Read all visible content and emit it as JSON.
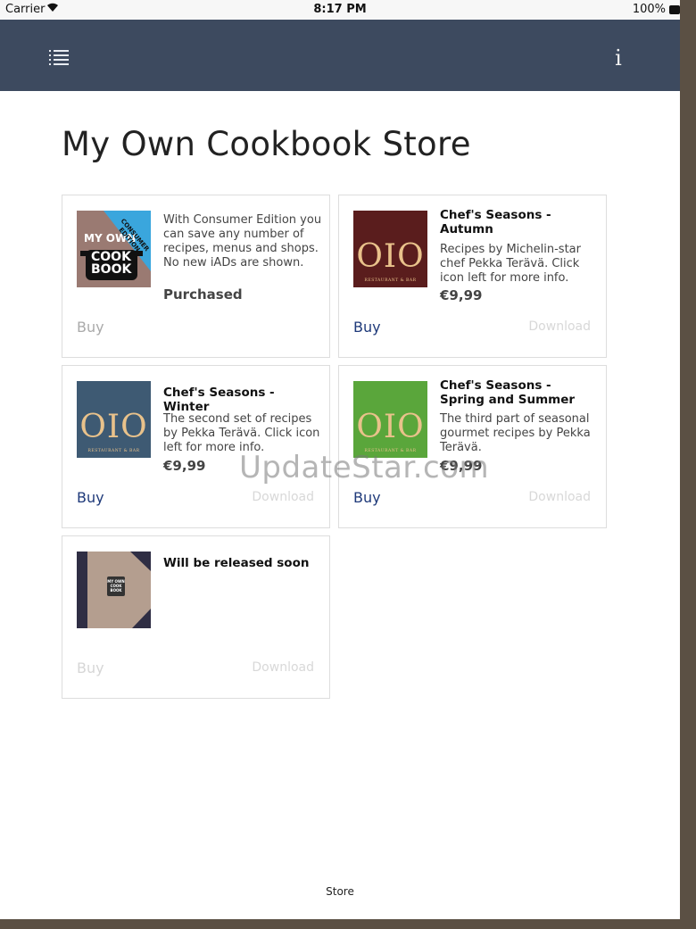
{
  "status_bar": {
    "carrier": "Carrier",
    "time": "8:17 PM",
    "battery": "100%"
  },
  "app_bar": {
    "menu_icon": "hamburger-list-icon",
    "info_label": "i"
  },
  "page": {
    "title": "My Own Cookbook Store",
    "footer_label": "Store"
  },
  "cards": [
    {
      "title": "",
      "description": "With Consumer Edition you can save any number of recipes, menus and shops. No new iADs are shown.",
      "status": "Purchased",
      "buy": "Buy",
      "thumb_lines": [
        "MY OWN",
        "COOK",
        "BOOK"
      ],
      "ribbon": "CONSUMER EDITION"
    },
    {
      "title": "Chef's Seasons - Autumn",
      "description": "Recipes by Michelin-star chef Pekka Terävä. Click icon left for more info.",
      "price": "€9,99",
      "buy": "Buy",
      "download": "Download",
      "thumb_word": "OIO",
      "thumb_sub": "RESTAURANT & BAR",
      "thumb_color": "#5a1d1d"
    },
    {
      "title": "Chef's Seasons - Winter",
      "description": "The second set of recipes by Pekka Terävä. Click icon left for more info.",
      "price": "€9,99",
      "buy": "Buy",
      "download": "Download",
      "thumb_word": "OIO",
      "thumb_sub": "RESTAURANT & BAR",
      "thumb_color": "#3e5a73"
    },
    {
      "title": "Chef's Seasons - Spring and Summer",
      "description": "The third part of seasonal gourmet recipes by Pekka Terävä.",
      "price": "€9,99",
      "buy": "Buy",
      "download": "Download",
      "thumb_word": "OIO",
      "thumb_sub": "RESTAURANT & BAR",
      "thumb_color": "#5aa63b"
    },
    {
      "title": "Will be released soon",
      "buy": "Buy",
      "download": "Download",
      "thumb_lines": [
        "MY OWN",
        "COOK",
        "BOOK"
      ]
    }
  ],
  "watermark": "UpdateStar.com",
  "colors": {
    "app_bar": "#3d4a5f",
    "link": "#1f3a7a",
    "disabled": "#aaaaaa"
  }
}
